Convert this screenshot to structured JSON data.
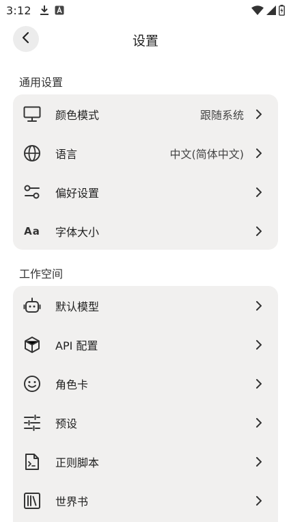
{
  "status_bar": {
    "time": "3:12",
    "left_icons": [
      "download-icon",
      "app-notification-icon"
    ],
    "right_icons": [
      "wifi-icon",
      "signal-icon",
      "battery-charging-icon"
    ]
  },
  "header": {
    "title": "设置",
    "back_icon": "chevron-left-icon"
  },
  "sections": [
    {
      "title": "通用设置",
      "items": [
        {
          "label": "颜色模式",
          "value": "跟随系统",
          "icon": "monitor-icon"
        },
        {
          "label": "语言",
          "value": "中文(简体中文)",
          "icon": "globe-icon"
        },
        {
          "label": "偏好设置",
          "value": "",
          "icon": "toggles-icon"
        },
        {
          "label": "字体大小",
          "value": "",
          "icon": "font-size-icon",
          "icon_text": "Aa"
        }
      ]
    },
    {
      "title": "工作空间",
      "items": [
        {
          "label": "默认模型",
          "icon": "robot-icon"
        },
        {
          "label": "API 配置",
          "icon": "cube-icon"
        },
        {
          "label": "角色卡",
          "icon": "smiley-icon"
        },
        {
          "label": "预设",
          "icon": "sliders-icon"
        },
        {
          "label": "正则脚本",
          "icon": "terminal-file-icon"
        },
        {
          "label": "世界书",
          "icon": "bookshelf-icon"
        }
      ]
    }
  ],
  "colors": {
    "card_background": "#f1f0ef",
    "text_primary": "#1f1f1f",
    "back_button_bg": "#ececec"
  }
}
